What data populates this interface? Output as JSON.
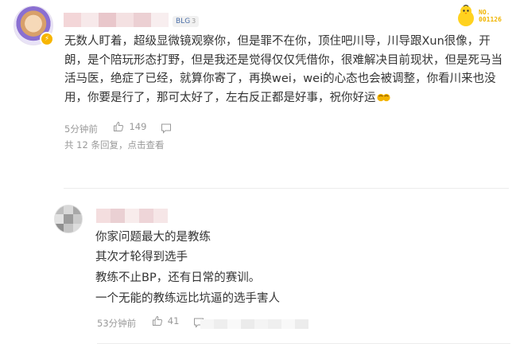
{
  "comment1": {
    "user_tag": "BLG",
    "user_tag_level": "3",
    "sticker_no": "NO.",
    "sticker_num": "001126",
    "text": "无数人盯着，超级显微镜观察你，但是罪不在你，顶住吧川导，川导跟Xun很像，开朗，是个陪玩形态打野，但是我还是觉得仅仅凭借你，很难解决目前现状，但是死马当活马医，绝症了已经，就算你寄了，再换wei，wei的心态也会被调整，你看川来也没用，你要是行了，那可太好了，左右反正都是好事，祝你好运",
    "time": "5分钟前",
    "likes": "149",
    "replies_summary": "共 12 条回复，点击查看",
    "icons": [
      "verified-badge-icon",
      "thumbs-up-icon",
      "comment-icon",
      "heart-eyes-emoji-icon"
    ]
  },
  "comment2": {
    "lines": [
      "你家问题最大的是教练",
      "其次才轮得到选手",
      "教练不止BP，还有日常的赛训。",
      "一个无能的教练远比坑逼的选手害人"
    ],
    "time": "53分钟前",
    "likes": "41",
    "icons": [
      "thumbs-up-icon",
      "comment-icon"
    ]
  },
  "colors": {
    "text": "#333333",
    "meta": "#999999",
    "tag_text": "#4c6fa8",
    "badge": "#f7b500",
    "sticker": "#f0b400"
  }
}
